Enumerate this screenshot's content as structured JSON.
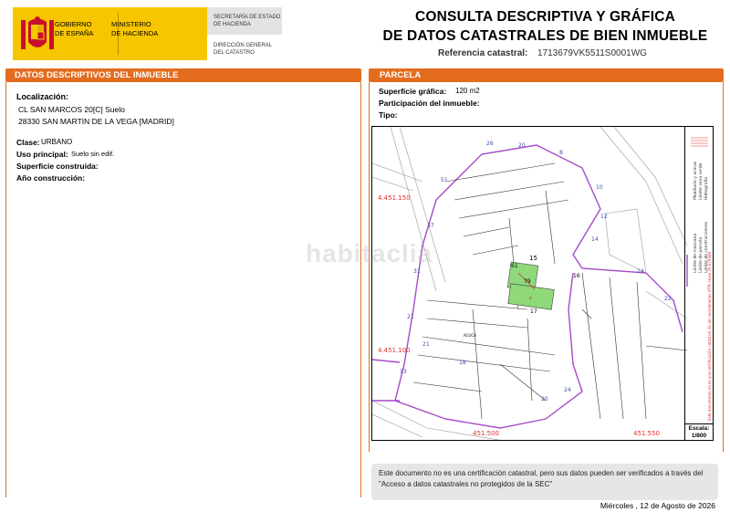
{
  "header": {
    "gov_line1": "GOBIERNO",
    "gov_line2": "DE ESPAÑA",
    "ministry_line1": "MINISTERIO",
    "ministry_line2": "DE HACIENDA",
    "sec_line1": "SECRETARÍA DE ESTADO",
    "sec_line2": "DE HACIENDA",
    "dir_line1": "DIRECCIÓN GENERAL",
    "dir_line2": "DEL CATASTRO",
    "title_line1": "CONSULTA DESCRIPTIVA Y GRÁFICA",
    "title_line2": "DE DATOS CATASTRALES DE BIEN INMUEBLE",
    "ref_label": "Referencia catastral:",
    "ref_value": "1713679VK5511S0001WG"
  },
  "left": {
    "section_title": "DATOS DESCRIPTIVOS DEL INMUEBLE",
    "localizacion_label": "Localización:",
    "address_line1": "CL SAN MARCOS 20[C] Suelo",
    "address_line2": "28330 SAN MARTIN DE LA VEGA [MADRID]",
    "clase_label": "Clase:",
    "clase_value": "URBANO",
    "uso_label": "Uso principal:",
    "uso_value": "Suelo sin edif.",
    "superficie_label": "Superficie construida:",
    "anio_label": "Año construcción:"
  },
  "right": {
    "section_title": "PARCELA",
    "superficie_label": "Superficie gráfica:",
    "superficie_value": "120 m2",
    "participacion_label": "Participación del inmueble:",
    "tipo_label": "Tipo:"
  },
  "map": {
    "coord_y1": "4.451.150",
    "coord_y2": "4.451.100",
    "coord_x1": "451.500",
    "coord_x2": "451.550",
    "parcel_labels": [
      "15",
      "61",
      "79",
      "16",
      "17",
      "P"
    ],
    "street_label": "ACUCA",
    "watermark": "habitaclia",
    "legend_lines": [
      "Límite de manzana",
      "Límite de parcela",
      "Límite de construcciones",
      "Mobiliario y aceras",
      "Límite zona verde",
      "Hidrografía"
    ],
    "legend_note": "Este documento no es una certificación catastral. En las coordenadas UTM, Huso 30 ETRS89",
    "scale_label": "Escala:",
    "scale_value": "1/800",
    "colors": {
      "block_line": "#a64ac9",
      "parcel_fill": "#8fd97a",
      "coord_text": "#e03030"
    }
  },
  "footer": {
    "note": "Este documento no es una certificación catastral, pero sus datos pueden ser verificados a través del \"Acceso a datos catastrales no protegidos de la SEC\"",
    "date": "Miércoles , 12 de Agosto de 2026"
  }
}
